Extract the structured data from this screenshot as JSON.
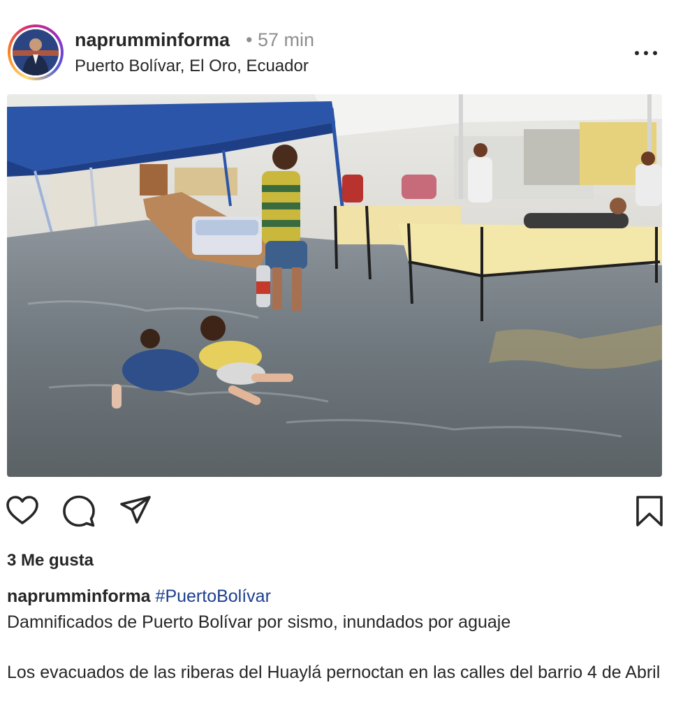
{
  "post": {
    "username": "naprumminforma",
    "time_separator": "•",
    "time_ago": "57 min",
    "location": "Puerto Bolívar, El Oro, Ecuador"
  },
  "icons": {
    "more": "more-options-icon",
    "like": "heart-icon",
    "comment": "comment-icon",
    "share": "share-icon",
    "save": "bookmark-icon"
  },
  "likes": {
    "label": "3 Me gusta"
  },
  "caption": {
    "username": "naprumminforma",
    "hashtag": "#PuertoBolívar",
    "line1": "Damnificados de Puerto Bolívar por sismo, inundados por aguaje",
    "line2": "Los evacuados de las riberas del Huaylá pernoctan en las calles del barrio 4 de Abril"
  },
  "colors": {
    "text": "#262626",
    "muted": "#8e8e8e",
    "hashtag": "#1c3f8f",
    "tent_blue": "#2b55a8"
  }
}
